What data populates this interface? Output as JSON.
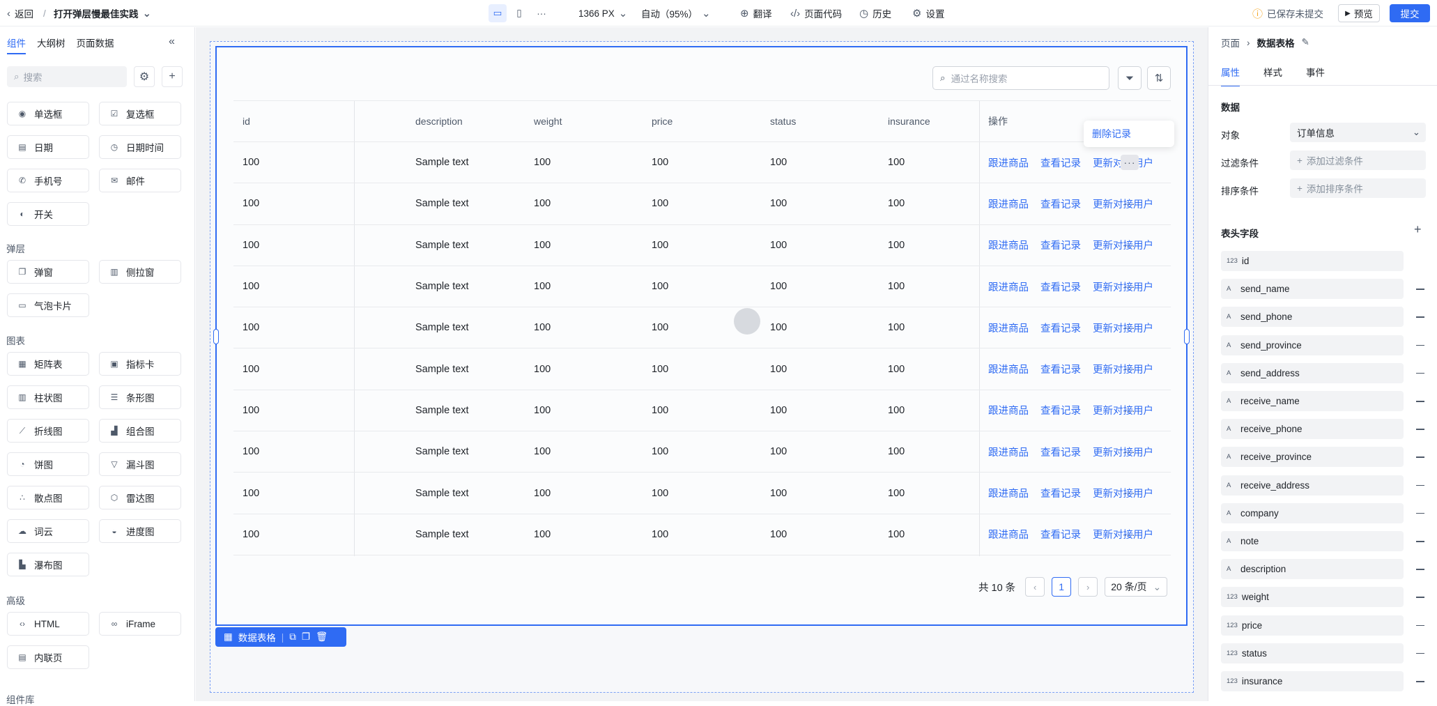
{
  "topbar": {
    "back_label": "返回",
    "separator": "/",
    "page_title": "打开弹层慢最佳实践",
    "width_label": "1366 PX",
    "zoom_label": "自动（95%）",
    "translate_label": "翻译",
    "code_label": "页面代码",
    "history_label": "历史",
    "settings_label": "设置",
    "save_status": "已保存未提交",
    "preview_label": "预览",
    "submit_label": "提交",
    "colors": {
      "primary": "#2f6bf3",
      "warning": "#f5a623"
    }
  },
  "left_panel": {
    "tabs": [
      "组件",
      "大纲树",
      "页面数据"
    ],
    "search_placeholder": "搜索",
    "form_components": [
      {
        "label": "单选框",
        "icon": "radio-icon"
      },
      {
        "label": "复选框",
        "icon": "checkbox-icon"
      },
      {
        "label": "日期",
        "icon": "calendar-icon"
      },
      {
        "label": "日期时间",
        "icon": "clock-icon"
      },
      {
        "label": "手机号",
        "icon": "phone-icon"
      },
      {
        "label": "邮件",
        "icon": "mail-icon"
      },
      {
        "label": "开关",
        "icon": "switch-icon"
      }
    ],
    "section_layer": "弹层",
    "layer_components": [
      {
        "label": "弹窗",
        "icon": "dialog-icon"
      },
      {
        "label": "侧拉窗",
        "icon": "drawer-icon"
      },
      {
        "label": "气泡卡片",
        "icon": "popover-icon"
      }
    ],
    "section_chart": "图表",
    "chart_components": [
      {
        "label": "矩阵表",
        "icon": "matrix-icon"
      },
      {
        "label": "指标卡",
        "icon": "metric-card-icon"
      },
      {
        "label": "柱状图",
        "icon": "bar-chart-icon"
      },
      {
        "label": "条形图",
        "icon": "horizontal-bar-icon"
      },
      {
        "label": "折线图",
        "icon": "line-chart-icon"
      },
      {
        "label": "组合图",
        "icon": "combo-chart-icon"
      },
      {
        "label": "饼图",
        "icon": "pie-chart-icon"
      },
      {
        "label": "漏斗图",
        "icon": "funnel-icon"
      },
      {
        "label": "散点图",
        "icon": "scatter-icon"
      },
      {
        "label": "雷达图",
        "icon": "radar-icon"
      },
      {
        "label": "词云",
        "icon": "wordcloud-icon"
      },
      {
        "label": "进度图",
        "icon": "progress-icon"
      },
      {
        "label": "瀑布图",
        "icon": "waterfall-icon"
      }
    ],
    "section_advanced": "高级",
    "advanced_components": [
      {
        "label": "HTML",
        "icon": "code-icon"
      },
      {
        "label": "iFrame",
        "icon": "link-icon"
      },
      {
        "label": "内联页",
        "icon": "page-icon"
      }
    ],
    "section_library": "组件库"
  },
  "table": {
    "search_placeholder": "通过名称搜索",
    "columns": [
      "id",
      "description",
      "weight",
      "price",
      "status",
      "insurance",
      "操作"
    ],
    "rows": [
      {
        "id": "100",
        "description": "Sample text",
        "weight": "100",
        "price": "100",
        "status": "100",
        "insurance": "100"
      },
      {
        "id": "100",
        "description": "Sample text",
        "weight": "100",
        "price": "100",
        "status": "100",
        "insurance": "100"
      },
      {
        "id": "100",
        "description": "Sample text",
        "weight": "100",
        "price": "100",
        "status": "100",
        "insurance": "100"
      },
      {
        "id": "100",
        "description": "Sample text",
        "weight": "100",
        "price": "100",
        "status": "100",
        "insurance": "100"
      },
      {
        "id": "100",
        "description": "Sample text",
        "weight": "100",
        "price": "100",
        "status": "100",
        "insurance": "100"
      },
      {
        "id": "100",
        "description": "Sample text",
        "weight": "100",
        "price": "100",
        "status": "100",
        "insurance": "100"
      },
      {
        "id": "100",
        "description": "Sample text",
        "weight": "100",
        "price": "100",
        "status": "100",
        "insurance": "100"
      },
      {
        "id": "100",
        "description": "Sample text",
        "weight": "100",
        "price": "100",
        "status": "100",
        "insurance": "100"
      },
      {
        "id": "100",
        "description": "Sample text",
        "weight": "100",
        "price": "100",
        "status": "100",
        "insurance": "100"
      },
      {
        "id": "100",
        "description": "Sample text",
        "weight": "100",
        "price": "100",
        "status": "100",
        "insurance": "100"
      }
    ],
    "actions": [
      "跟进商品",
      "查看记录",
      "更新对接用户"
    ],
    "more_label": "···",
    "dropdown_item": "删除记录",
    "total_label": "共 10 条",
    "current_page": "1",
    "page_size": "20 条/页",
    "component_label": "数据表格"
  },
  "right_panel": {
    "breadcrumb_parent": "页面",
    "breadcrumb_current": "数据表格",
    "tabs": [
      "属性",
      "样式",
      "事件"
    ],
    "section_data": "数据",
    "object_label": "对象",
    "object_value": "订单信息",
    "filter_label": "过滤条件",
    "filter_placeholder": "添加过滤条件",
    "sort_label": "排序条件",
    "sort_placeholder": "添加排序条件",
    "section_header_fields": "表头字段",
    "fields": [
      {
        "type": "123",
        "name": "id"
      },
      {
        "type": "A",
        "name": "send_name"
      },
      {
        "type": "A",
        "name": "send_phone"
      },
      {
        "type": "A",
        "name": "send_province"
      },
      {
        "type": "A",
        "name": "send_address"
      },
      {
        "type": "A",
        "name": "receive_name"
      },
      {
        "type": "A",
        "name": "receive_phone"
      },
      {
        "type": "A",
        "name": "receive_province"
      },
      {
        "type": "A",
        "name": "receive_address"
      },
      {
        "type": "A",
        "name": "company"
      },
      {
        "type": "A",
        "name": "note"
      },
      {
        "type": "A",
        "name": "description"
      },
      {
        "type": "123",
        "name": "weight"
      },
      {
        "type": "123",
        "name": "price"
      },
      {
        "type": "123",
        "name": "status"
      },
      {
        "type": "123",
        "name": "insurance"
      }
    ]
  }
}
